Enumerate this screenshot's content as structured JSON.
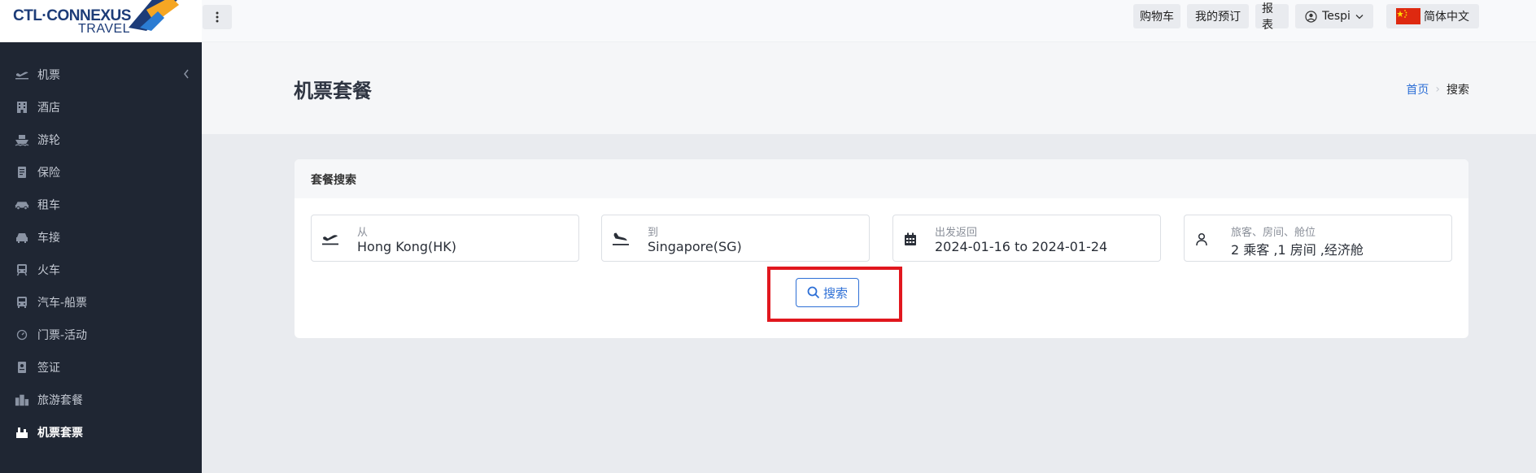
{
  "brand": {
    "logo_line1": "CTL·CONNEXUS",
    "logo_line2": "TRAVEL",
    "colors": {
      "navy": "#1d3c78",
      "orange": "#f5a623",
      "sidebar": "#1f2633",
      "accent": "#2d6fd6",
      "highlight": "#e1171e"
    }
  },
  "sidebar": {
    "items": [
      {
        "label": "机票",
        "icon": "plane-takeoff-icon"
      },
      {
        "label": "酒店",
        "icon": "hotel-icon"
      },
      {
        "label": "游轮",
        "icon": "ship-icon"
      },
      {
        "label": "保险",
        "icon": "document-icon"
      },
      {
        "label": "租车",
        "icon": "car-icon"
      },
      {
        "label": "车接",
        "icon": "car-pickup-icon"
      },
      {
        "label": "火车",
        "icon": "train-icon"
      },
      {
        "label": "汽车-船票",
        "icon": "bus-icon"
      },
      {
        "label": "门票-活动",
        "icon": "ticket-icon"
      },
      {
        "label": "签证",
        "icon": "passport-icon"
      },
      {
        "label": "旅游套餐",
        "icon": "city-icon"
      },
      {
        "label": "机票套票",
        "icon": "package-icon"
      }
    ],
    "active_index": 11
  },
  "topbar": {
    "cart": "购物车",
    "bookings": "我的预订",
    "reports": "报表",
    "user": "Tespi",
    "language": "简体中文"
  },
  "header": {
    "title": "机票套餐",
    "breadcrumb_home": "首页",
    "breadcrumb_current": "搜索"
  },
  "card": {
    "title": "套餐搜索",
    "from_label": "从",
    "from_value": "Hong Kong(HK)",
    "to_label": "到",
    "to_value": "Singapore(SG)",
    "dates_label": "出发返回",
    "dates_value": "2024-01-16 to 2024-01-24",
    "guests_label": "旅客、房间、舱位",
    "guests_value": "2 乘客 ,1 房间 ,经济舱",
    "search_label": "搜索"
  }
}
